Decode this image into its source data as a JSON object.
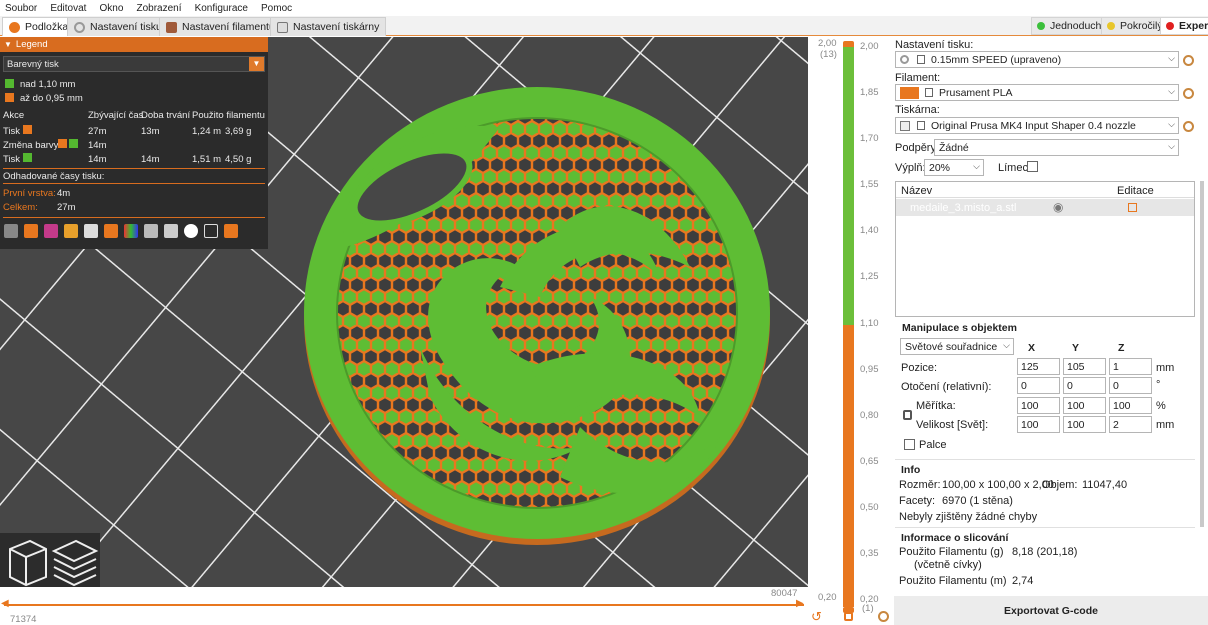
{
  "menu": [
    "Soubor",
    "Editovat",
    "Okno",
    "Zobrazení",
    "Konfigurace",
    "Pomoc"
  ],
  "tabs": [
    "Podložka",
    "Nastavení tisku",
    "Nastavení filamentu",
    "Nastavení tiskárny"
  ],
  "modes": [
    {
      "label": "Jednoduchý",
      "color": "#3bbf3b"
    },
    {
      "label": "Pokročilý",
      "color": "#e8c62b"
    },
    {
      "label": "Expert",
      "color": "#e02020"
    }
  ],
  "legend": {
    "title": "Legend",
    "view_type": "Barevný tisk",
    "ranges": [
      {
        "label": "nad 1,10 mm",
        "color": "#54b830"
      },
      {
        "label": "až do 0,95 mm",
        "color": "#e8771f"
      }
    ],
    "columns": [
      "Akce",
      "Zbývající čas",
      "Doba trvání",
      "Použito filamentu"
    ],
    "rows": [
      {
        "action": "Tisk",
        "remaining": "27m",
        "duration": "13m",
        "used_len": "1,24 m",
        "used_weight": "3,69 g"
      },
      {
        "action": "Změna barvy",
        "remaining": "14m",
        "duration": "",
        "used_len": "",
        "used_weight": ""
      },
      {
        "action": "Tisk",
        "remaining": "14m",
        "duration": "14m",
        "used_len": "1,51 m",
        "used_weight": "4,50 g"
      }
    ],
    "estimated_label": "Odhadované časy tisku:",
    "first_layer_label": "První vrstva:",
    "first_layer_value": "4m",
    "total_label": "Celkem:",
    "total_value": "27m"
  },
  "vslider": {
    "top_value": "2,00",
    "top_layer": "(13)",
    "ticks": [
      "2,00",
      "1,85",
      "1,70",
      "1,55",
      "1,40",
      "1,25",
      "1,10",
      "0,95",
      "0,80",
      "0,65",
      "0,50",
      "0,35",
      "0,20"
    ],
    "bottom_value": "0,20",
    "bottom_layer": "(1)"
  },
  "hslider": {
    "left_value": "71374",
    "right_value": "80047"
  },
  "right": {
    "print_settings_label": "Nastavení tisku:",
    "print_profile": "0.15mm SPEED (upraveno)",
    "filament_label": "Filament:",
    "filament_profile": "Prusament PLA",
    "filament_color": "#e8771f",
    "printer_label": "Tiskárna:",
    "printer_profile": "Original Prusa MK4 Input Shaper 0.4 nozzle",
    "supports_label": "Podpěry:",
    "supports_value": "Žádné",
    "infill_label": "Výplň:",
    "infill_value": "20%",
    "brim_label": "Límec:",
    "list_col_name": "Název",
    "list_col_edit": "Editace",
    "object_name": "medaile_3.misto_a.stl",
    "manip_title": "Manipulace s objektem",
    "coord_mode": "Světové souřadnice",
    "axes": [
      "X",
      "Y",
      "Z"
    ],
    "position_label": "Pozice:",
    "position": [
      "125",
      "105",
      "1"
    ],
    "position_unit": "mm",
    "rotation_label": "Otočení (relativní):",
    "rotation": [
      "0",
      "0",
      "0"
    ],
    "rotation_unit": "°",
    "scale_label": "Měřítka:",
    "scale": [
      "100",
      "100",
      "100"
    ],
    "scale_unit": "%",
    "size_label": "Velikost [Svět]:",
    "size": [
      "100",
      "100",
      "2"
    ],
    "size_unit": "mm",
    "inches_label": "Palce",
    "info_title": "Info",
    "size_info_label": "Rozměr:",
    "size_info_value": "100,00 x 100,00 x 2,00",
    "volume_label": "Objem:",
    "volume_value": "11047,40",
    "facets_label": "Facety:",
    "facets_value": "6970 (1 stěna)",
    "errors": "Nebyly zjištěny žádné chyby",
    "slice_title": "Informace o slicování",
    "used_g_label": "Použito Filamentu (g)",
    "used_g_sub": "(včetně cívky)",
    "used_g_value": "8,18 (201,18)",
    "used_m_label": "Použito Filamentu (m)",
    "used_m_value": "2,74",
    "export_label": "Exportovat G-code"
  }
}
